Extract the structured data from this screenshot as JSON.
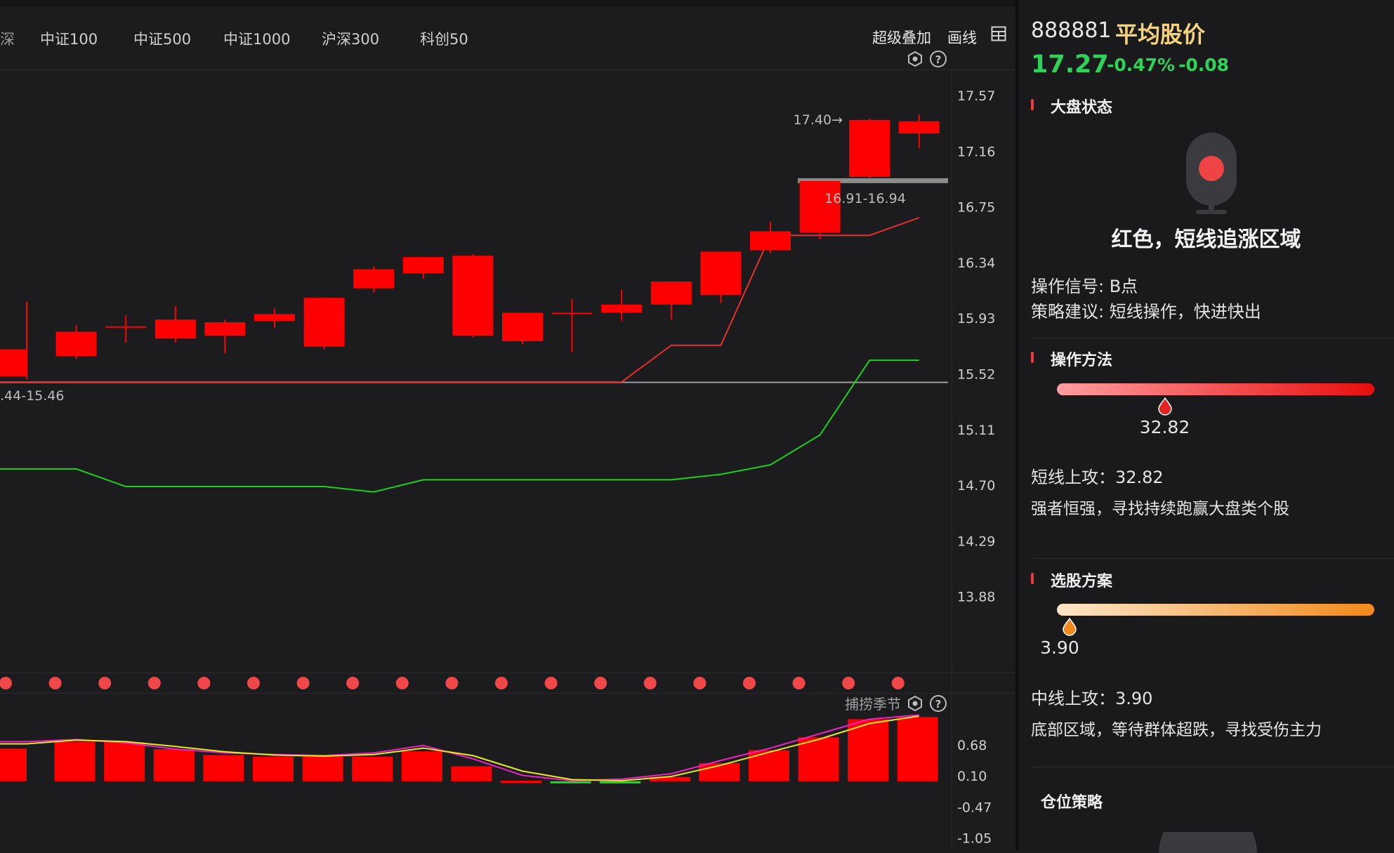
{
  "tabs": {
    "partial_first": "深",
    "items": [
      "中证100",
      "中证500",
      "中证1000",
      "沪深300",
      "科创50"
    ]
  },
  "tools": {
    "overlay": "超级叠加",
    "draw": "画线"
  },
  "colors": {
    "up": "#ff0000",
    "down_line": "#e53030",
    "support": "#1bd11b",
    "bg": "#1c1c1e",
    "accent_yellow": "#f6d27a",
    "green_text": "#2fd35a"
  },
  "main_chart": {
    "y_ticks": [
      "17.57",
      "17.16",
      "16.75",
      "16.34",
      "15.93",
      "15.52",
      "15.11",
      "14.70",
      "14.29",
      "13.88"
    ],
    "label_top": "17.40→",
    "label_zone": "16.91-16.94",
    "label_left": ".44-15.46"
  },
  "chart_data": [
    {
      "type": "candlestick",
      "ylim": [
        13.7,
        17.72
      ],
      "candles": [
        {
          "o": 15.5,
          "c": 15.7,
          "h": 16.05,
          "l": 15.48
        },
        {
          "o": 15.65,
          "c": 15.83,
          "h": 15.88,
          "l": 15.63
        },
        {
          "o": 15.87,
          "c": 15.87,
          "h": 15.95,
          "l": 15.75
        },
        {
          "o": 15.78,
          "c": 15.92,
          "h": 16.02,
          "l": 15.75
        },
        {
          "o": 15.8,
          "c": 15.9,
          "h": 15.92,
          "l": 15.67
        },
        {
          "o": 15.91,
          "c": 15.96,
          "h": 16.0,
          "l": 15.86
        },
        {
          "o": 15.72,
          "c": 16.08,
          "h": 16.08,
          "l": 15.7
        },
        {
          "o": 16.15,
          "c": 16.29,
          "h": 16.31,
          "l": 16.12
        },
        {
          "o": 16.26,
          "c": 16.38,
          "h": 16.38,
          "l": 16.22
        },
        {
          "o": 15.8,
          "c": 16.39,
          "h": 16.4,
          "l": 15.79
        },
        {
          "o": 15.76,
          "c": 15.97,
          "h": 15.97,
          "l": 15.74
        },
        {
          "o": 15.97,
          "c": 15.97,
          "h": 16.07,
          "l": 15.68
        },
        {
          "o": 15.97,
          "c": 16.03,
          "h": 16.14,
          "l": 15.91
        },
        {
          "o": 16.03,
          "c": 16.2,
          "h": 16.2,
          "l": 15.92
        },
        {
          "o": 16.1,
          "c": 16.42,
          "h": 16.42,
          "l": 16.04
        },
        {
          "o": 16.43,
          "c": 16.57,
          "h": 16.64,
          "l": 16.41
        },
        {
          "o": 16.56,
          "c": 16.94,
          "h": 16.94,
          "l": 16.51
        },
        {
          "o": 16.97,
          "c": 17.39,
          "h": 17.4,
          "l": 16.96
        },
        {
          "o": 17.29,
          "c": 17.38,
          "h": 17.43,
          "l": 17.18
        }
      ],
      "red_line": [
        15.46,
        15.46,
        15.46,
        15.46,
        15.46,
        15.46,
        15.46,
        15.46,
        15.46,
        15.46,
        15.46,
        15.46,
        15.46,
        15.73,
        15.73,
        16.54,
        16.54,
        16.54,
        16.67
      ],
      "green_line": [
        14.82,
        14.82,
        14.69,
        14.69,
        14.69,
        14.69,
        14.69,
        14.65,
        14.74,
        14.74,
        14.74,
        14.74,
        14.74,
        14.74,
        14.78,
        14.85,
        15.07,
        15.62,
        15.62
      ],
      "ref_line": 15.46,
      "zone_line": 16.94
    },
    {
      "type": "bar",
      "title": "捕捞季节",
      "ylim": [
        -1.05,
        1.28
      ],
      "y_ticks": [
        "0.68",
        "0.10",
        "-0.47",
        "-1.05"
      ],
      "values": [
        0.61,
        0.74,
        0.73,
        0.6,
        0.49,
        0.46,
        0.46,
        0.46,
        0.56,
        0.28,
        0.01,
        -0.02,
        -0.04,
        0.08,
        0.34,
        0.58,
        0.82,
        1.16,
        1.2
      ],
      "line_magenta": [
        0.74,
        0.78,
        0.72,
        0.6,
        0.53,
        0.5,
        0.48,
        0.53,
        0.67,
        0.42,
        0.11,
        0.01,
        0.04,
        0.14,
        0.39,
        0.62,
        0.89,
        1.16,
        1.24
      ],
      "line_yellow": [
        0.7,
        0.77,
        0.74,
        0.65,
        0.55,
        0.49,
        0.47,
        0.5,
        0.62,
        0.48,
        0.19,
        0.03,
        0.01,
        0.09,
        0.3,
        0.55,
        0.79,
        1.08,
        1.22
      ]
    }
  ],
  "right_panel": {
    "code": "888881",
    "name": "平均股价",
    "price": "17.27",
    "pct": "-0.47%",
    "change": "-0.08",
    "market_state": {
      "title": "大盘状态",
      "status": "红色，短线追涨区域",
      "signal": "操作信号: B点",
      "advice": "策略建议: 短线操作，快进快出"
    },
    "method": {
      "title": "操作方法",
      "gauge_value_label": "32.82",
      "gauge_fraction": 0.34,
      "line1": "短线上攻：32.82",
      "line2": "强者恒强，寻找持续跑赢大盘类个股"
    },
    "selection": {
      "title": "选股方案",
      "gauge_value_label": "3.90",
      "gauge_fraction": 0.04,
      "line1": "中线上攻：3.90",
      "line2": "底部区域，等待群体超跌，寻找受伤主力"
    },
    "position": {
      "title": "仓位策略"
    }
  }
}
